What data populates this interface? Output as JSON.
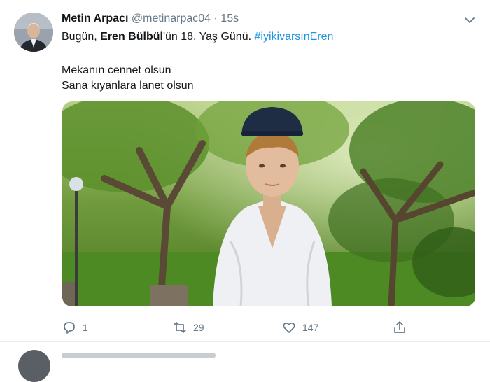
{
  "tweet": {
    "author_name": "Metin Arpacı",
    "author_handle": "@metinarpac04",
    "separator": "·",
    "time": "15s",
    "line1": {
      "prefix": "Bugün, ",
      "bold": "Eren Bülbül",
      "middle": "'ün 18. Yaş Günü. ",
      "hashtag": "#iyikivarsınEren"
    },
    "line2": "Mekanın cennet olsun",
    "line3": "Sana kıyanlara lanet olsun",
    "photo_alt": "Young man in a dark cap and white shirt among trees in a park",
    "actions": {
      "reply_count": "1",
      "retweet_count": "29",
      "like_count": "147"
    }
  },
  "colors": {
    "accent": "#1b95e0",
    "secondary_text": "#657786",
    "divider": "#e6ecf0"
  },
  "icons": [
    "avatar",
    "chevron-down-icon",
    "reply-icon",
    "retweet-icon",
    "like-icon",
    "share-icon"
  ]
}
